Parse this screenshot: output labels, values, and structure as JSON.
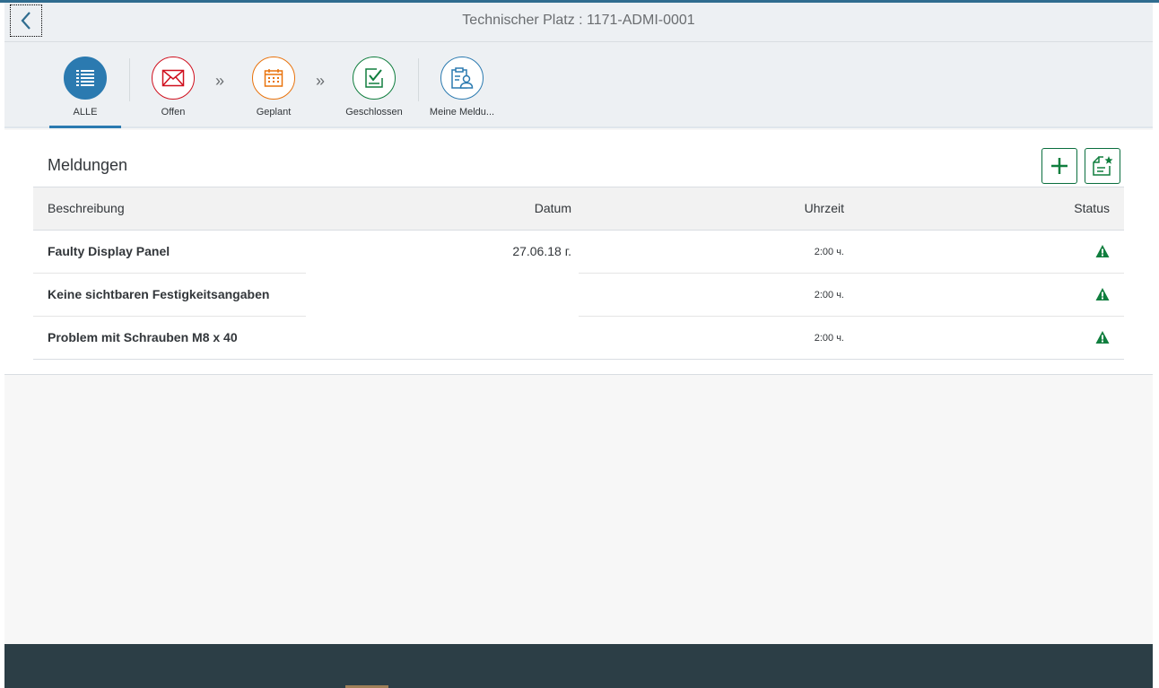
{
  "header": {
    "title": "Technischer Platz : 1171-ADMI-0001"
  },
  "tabs": [
    {
      "label": "ALLE",
      "icon": "list-icon",
      "color": "#2b7ab0"
    },
    {
      "label": "Offen",
      "icon": "envelope-icon",
      "color": "#d0101e"
    },
    {
      "label": "Geplant",
      "icon": "calendar-icon",
      "color": "#e9730c"
    },
    {
      "label": "Geschlossen",
      "icon": "checklist-icon",
      "color": "#107e3e"
    },
    {
      "label": "Meine Meldu...",
      "icon": "clipboard-user-icon",
      "color": "#2b7ab0"
    }
  ],
  "arrows": {
    "first": "»",
    "second": "»"
  },
  "list": {
    "title": "Meldungen",
    "columns": [
      "Beschreibung",
      "Datum",
      "Uhrzeit",
      "Status"
    ],
    "rows": [
      {
        "description": "Faulty Display Panel",
        "date": "27.06.18 г.",
        "time": "2:00 ч.",
        "status": "warning-icon"
      },
      {
        "description": "Keine sichtbaren Festigkeitsangaben",
        "date": "",
        "time": "2:00 ч.",
        "status": "warning-icon"
      },
      {
        "description": "Problem mit Schrauben M8 x 40",
        "date": "",
        "time": "2:00 ч.",
        "status": "warning-icon"
      }
    ]
  },
  "colors": {
    "status_warning": "#107e3e",
    "accent": "#2b7ab0",
    "footer": "#2c3e46"
  }
}
